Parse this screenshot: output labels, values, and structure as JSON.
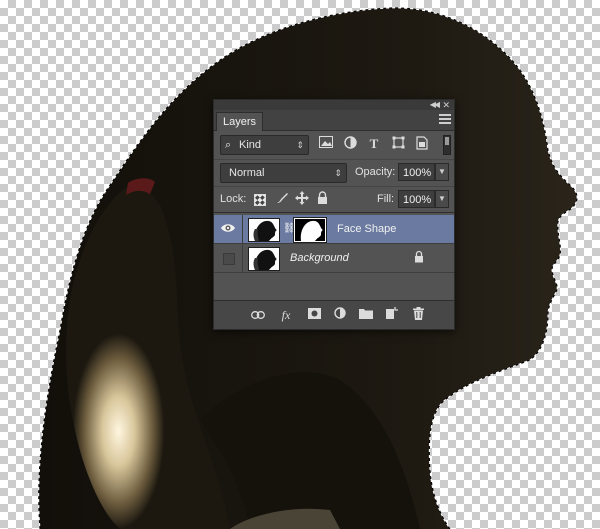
{
  "panel": {
    "tab_label": "Layers",
    "filter": {
      "kind_label": "Kind",
      "icons": [
        "image-filter-icon",
        "adjustment-filter-icon",
        "type-filter-icon",
        "shape-filter-icon",
        "smart-object-filter-icon"
      ]
    },
    "blend_mode": "Normal",
    "opacity_label": "Opacity:",
    "opacity_value": "100%",
    "lock_label": "Lock:",
    "fill_label": "Fill:",
    "fill_value": "100%",
    "layers": [
      {
        "name": "Face Shape",
        "visible": true,
        "selected": true,
        "has_mask": true
      },
      {
        "name": "Background",
        "visible": false,
        "selected": false,
        "locked": true
      }
    ],
    "bottom_buttons": [
      "link-layers-icon",
      "fx-icon",
      "add-mask-icon",
      "adjustment-layer-icon",
      "new-group-icon",
      "new-layer-icon",
      "trash-icon"
    ]
  },
  "colors": {
    "panel_bg": "#535353",
    "selected_row": "#6a7aa0",
    "silhouette": "#1c1810"
  }
}
